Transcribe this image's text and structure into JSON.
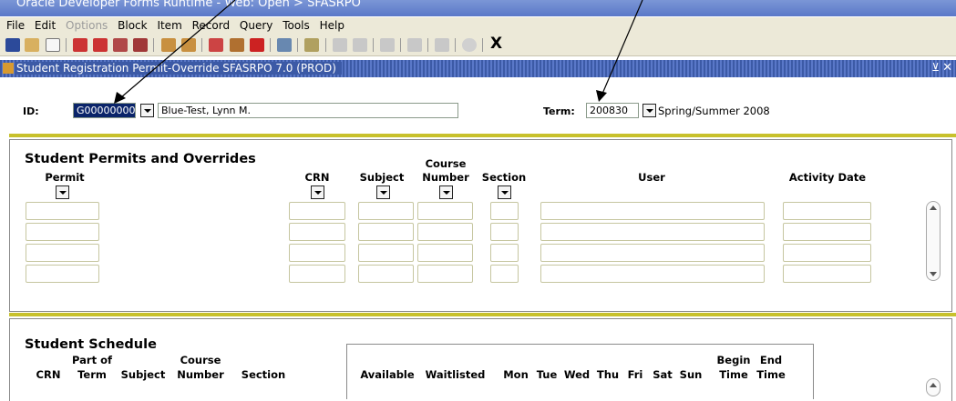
{
  "window": {
    "title": "Oracle Developer Forms Runtime - Web: Open > SFASRPO"
  },
  "menu": [
    "File",
    "Edit",
    "Options",
    "Block",
    "Item",
    "Record",
    "Query",
    "Tools",
    "Help"
  ],
  "menu_disabled": [
    "Options"
  ],
  "toolbar": {
    "close_label": "X"
  },
  "form": {
    "title": "Student Registration Permit-Override  SFASRPO  7.0  (PROD)"
  },
  "key_block": {
    "id_label": "ID:",
    "id_value": "G00000000",
    "name_value": "Blue-Test, Lynn M.",
    "term_label": "Term:",
    "term_value": "200830",
    "term_desc": "Spring/Summer 2008"
  },
  "permits": {
    "heading": "Student Permits and Overrides",
    "columns": {
      "permit": "Permit",
      "crn": "CRN",
      "subject": "Subject",
      "course_line1": "Course",
      "course_line2": "Number",
      "section": "Section",
      "user": "User",
      "activity_date": "Activity Date"
    }
  },
  "schedule": {
    "heading": "Student Schedule",
    "columns": {
      "crn": "CRN",
      "part_line1": "Part of",
      "part_line2": "Term",
      "subject": "Subject",
      "course_line1": "Course",
      "course_line2": "Number",
      "section": "Section",
      "available": "Available",
      "waitlisted": "Waitlisted",
      "mon": "Mon",
      "tue": "Tue",
      "wed": "Wed",
      "thu": "Thu",
      "fri": "Fri",
      "sat": "Sat",
      "sun": "Sun",
      "begin_line1": "Begin",
      "begin_line2": "Time",
      "end_line1": "End",
      "end_line2": "Time"
    }
  },
  "colors": {
    "titlebar": "#5a78c8",
    "accent_yellow": "#c8c12c",
    "selection": "#0a246a"
  }
}
